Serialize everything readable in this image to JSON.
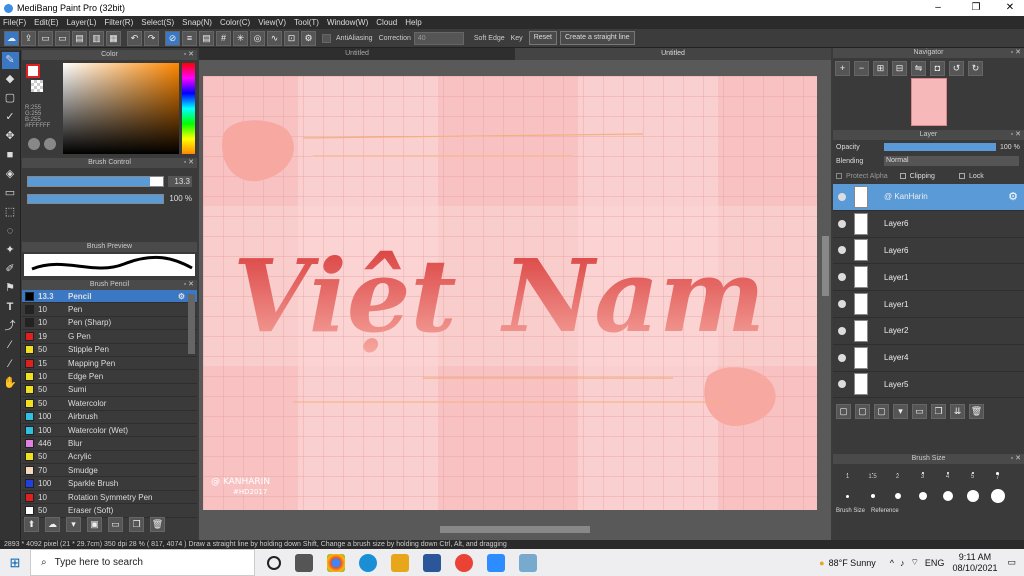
{
  "window": {
    "title": "MediBang Paint Pro (32bit)",
    "min": "–",
    "max": "❐",
    "close": "✕"
  },
  "menu": [
    "File(F)",
    "Edit(E)",
    "Layer(L)",
    "Filter(R)",
    "Select(S)",
    "Snap(N)",
    "Color(C)",
    "View(V)",
    "Tool(T)",
    "Window(W)",
    "Cloud",
    "Help"
  ],
  "toolbar": {
    "antialias": "AntiAliasing",
    "correction_label": "Correction",
    "correction_value": "40",
    "soft_edge": "Soft Edge",
    "key": "Key",
    "reset": "Reset",
    "straight_line": "Create a straight line"
  },
  "color_panel": {
    "title": "Color",
    "r": "R:255",
    "g": "G:255",
    "b": "B:255",
    "hex": "#FFFFFF"
  },
  "brush_control": {
    "title": "Brush Control",
    "size": "13.3",
    "opacity": "100 %",
    "size_fill": 0.9,
    "opacity_fill": 1.0
  },
  "brush_preview": {
    "title": "Brush Preview"
  },
  "brush_list": {
    "title": "Brush Pencil",
    "items": [
      {
        "size": "13.3",
        "name": "Pencil",
        "color": "#000000",
        "selected": true
      },
      {
        "size": "10",
        "name": "Pen",
        "color": "#222222"
      },
      {
        "size": "10",
        "name": "Pen (Sharp)",
        "color": "#222222"
      },
      {
        "size": "19",
        "name": "G Pen",
        "color": "#e02020"
      },
      {
        "size": "50",
        "name": "Stipple Pen",
        "color": "#f0e020"
      },
      {
        "size": "15",
        "name": "Mapping Pen",
        "color": "#e02020"
      },
      {
        "size": "10",
        "name": "Edge Pen",
        "color": "#f0e020"
      },
      {
        "size": "50",
        "name": "Sumi",
        "color": "#f0e020"
      },
      {
        "size": "50",
        "name": "Watercolor",
        "color": "#f0e020"
      },
      {
        "size": "100",
        "name": "Airbrush",
        "color": "#30c0e0"
      },
      {
        "size": "100",
        "name": "Watercolor (Wet)",
        "color": "#30c0e0"
      },
      {
        "size": "446",
        "name": "Blur",
        "color": "#e080e0"
      },
      {
        "size": "50",
        "name": "Acrylic",
        "color": "#f0e020"
      },
      {
        "size": "70",
        "name": "Smudge",
        "color": "#f4d8c0"
      },
      {
        "size": "100",
        "name": "Sparkle Brush",
        "color": "#2040e0"
      },
      {
        "size": "10",
        "name": "Rotation Symmetry Pen",
        "color": "#e02020"
      },
      {
        "size": "50",
        "name": "Eraser (Soft)",
        "color": "#ffffff"
      }
    ]
  },
  "tabs": [
    "Untitled",
    "Untitled"
  ],
  "canvas_text": {
    "title_left": "Việt",
    "title_right": "Nam",
    "credit": "@ KANHARIN",
    "tag": "#HD2017"
  },
  "navigator": {
    "title": "Navigator"
  },
  "layer_panel": {
    "title": "Layer",
    "opacity_label": "Opacity",
    "opacity_value": "100 %",
    "blending_label": "Blending",
    "blending_value": "Normal",
    "protect_alpha": "Protect Alpha",
    "clipping": "Clipping",
    "lock": "Lock",
    "layers": [
      {
        "name": "@ KanHarin",
        "selected": true
      },
      {
        "name": "Layer6"
      },
      {
        "name": "Layer6"
      },
      {
        "name": "Layer1"
      },
      {
        "name": "Layer1"
      },
      {
        "name": "Layer2"
      },
      {
        "name": "Layer4"
      },
      {
        "name": "Layer5"
      }
    ]
  },
  "brush_size": {
    "title": "Brush Size",
    "labels": [
      "1",
      "1.5",
      "2",
      "3",
      "4",
      "5",
      "7"
    ],
    "tabs": [
      "Brush Size",
      "Reference"
    ]
  },
  "status": "2893 * 4092 pixel   (21 * 29.7cm)   350 dpi   28 %   ( 817, 4074 )   Draw a straight line by holding down Shift, Change a brush size by holding down Ctrl, Alt, and dragging",
  "taskbar": {
    "search_placeholder": "Type here to search",
    "weather": "88°F  Sunny",
    "lang": "ENG",
    "time": "9:11 AM",
    "date": "08/10/2021"
  }
}
